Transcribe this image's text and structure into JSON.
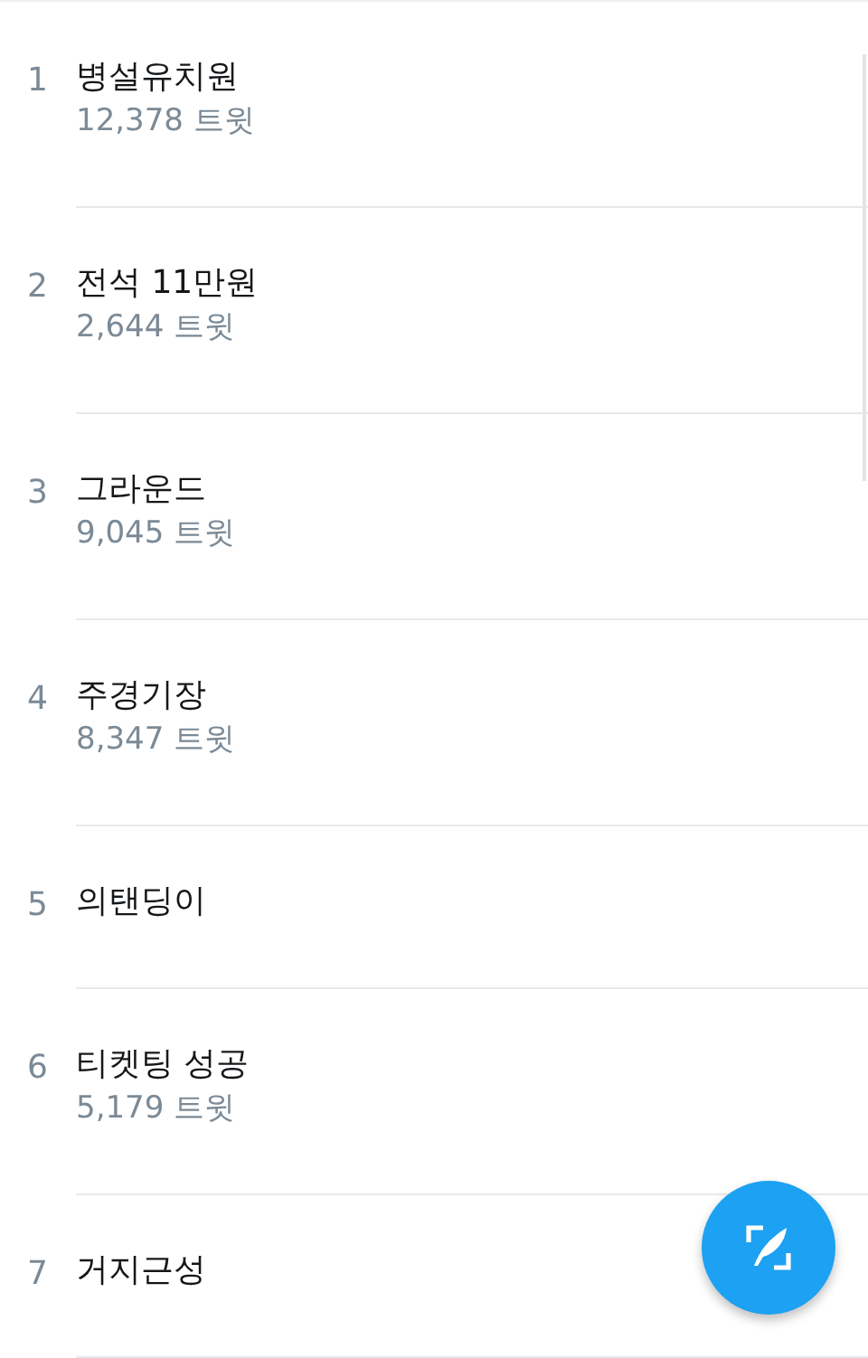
{
  "trends": [
    {
      "rank": "1",
      "name": "병설유치원",
      "count": "12,378 트윗"
    },
    {
      "rank": "2",
      "name": "전석 11만원",
      "count": "2,644 트윗"
    },
    {
      "rank": "3",
      "name": "그라운드",
      "count": "9,045 트윗"
    },
    {
      "rank": "4",
      "name": "주경기장",
      "count": "8,347 트윗"
    },
    {
      "rank": "5",
      "name": "의탠딩이"
    },
    {
      "rank": "6",
      "name": "티켓팅 성공",
      "count": "5,179 트윗"
    },
    {
      "rank": "7",
      "name": "거지근성"
    }
  ]
}
